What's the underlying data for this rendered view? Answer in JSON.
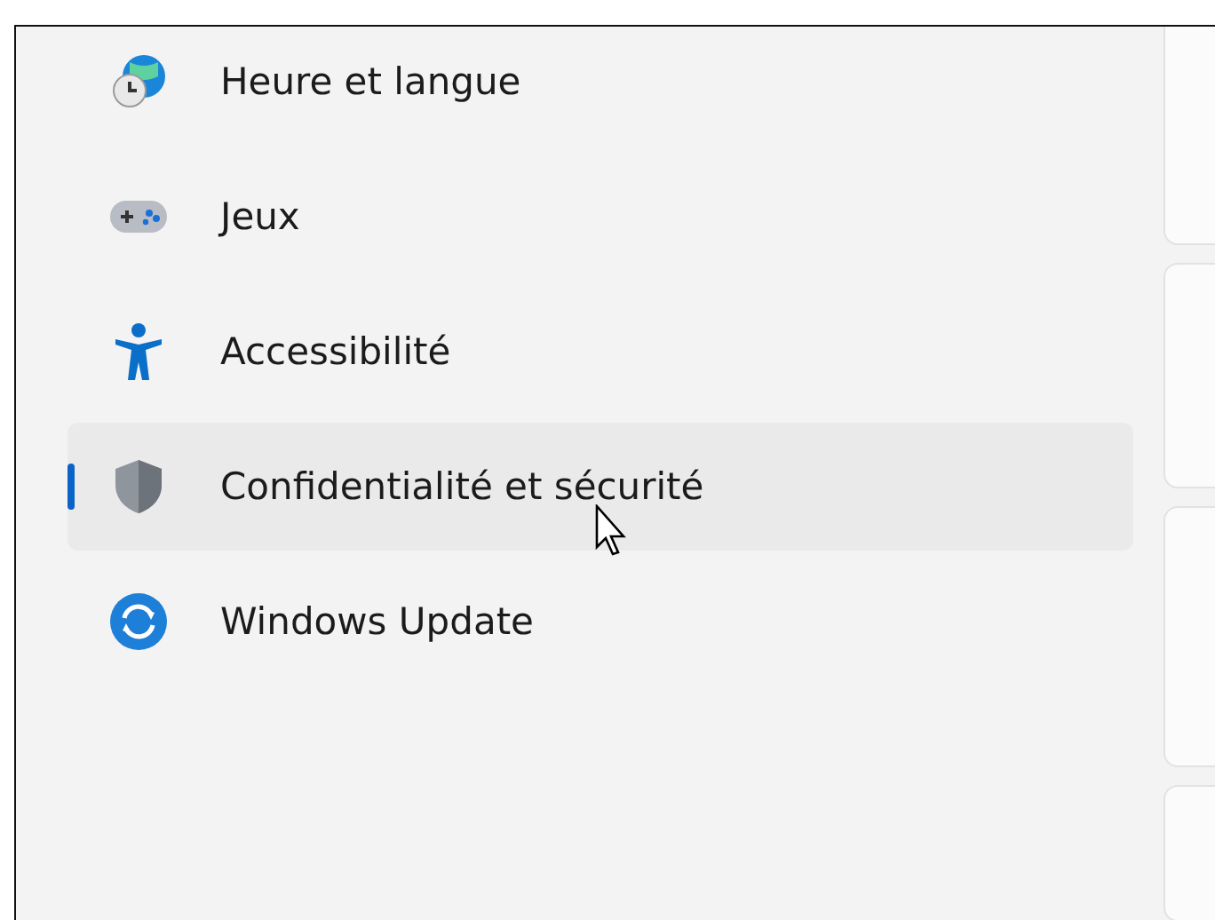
{
  "sidebar": {
    "items": [
      {
        "label": "Heure et langue",
        "kind": "time",
        "selected": false
      },
      {
        "label": "Jeux",
        "kind": "games",
        "selected": false
      },
      {
        "label": "Accessibilité",
        "kind": "accessibility",
        "selected": false
      },
      {
        "label": "Confidentialité et sécurité",
        "kind": "privacy",
        "selected": true
      },
      {
        "label": "Windows Update",
        "kind": "update",
        "selected": false
      }
    ]
  }
}
